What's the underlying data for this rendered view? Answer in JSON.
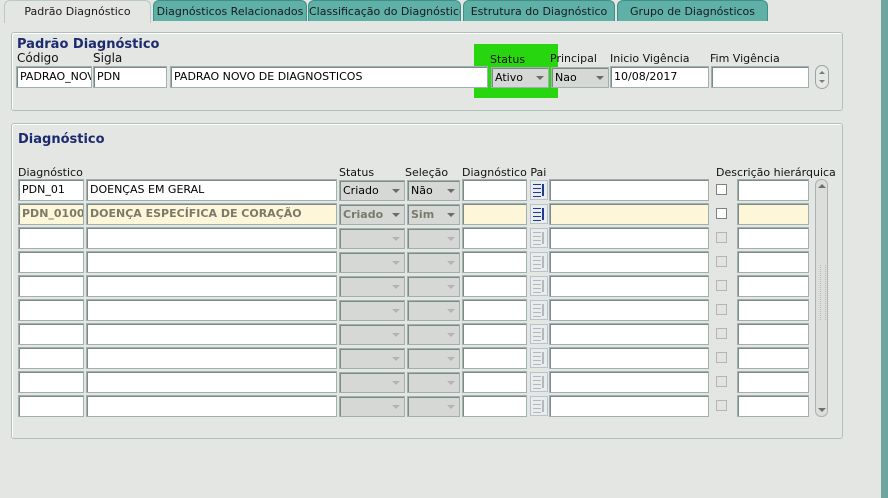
{
  "tabs": [
    {
      "label": "Padrão Diagnóstico",
      "active": true
    },
    {
      "label": "Diagnósticos Relacionados"
    },
    {
      "label": "Classificação do Diagnóstico"
    },
    {
      "label": "Estrutura do Diagnóstico"
    },
    {
      "label": "Grupo de Diagnósticos"
    }
  ],
  "header_panel": {
    "title": "Padrão Diagnóstico",
    "labels": {
      "codigo": "Código",
      "sigla": "Sigla",
      "status": "Status",
      "principal": "Principal",
      "inicio": "Inicio Vigência",
      "fim": "Fim Vigência"
    },
    "codigo": "PADRAO_NOV",
    "sigla": "PDN",
    "descricao": "PADRAO NOVO DE DIAGNOSTICOS",
    "status": "Ativo",
    "principal": "Nao",
    "inicio": "10/08/2017",
    "fim": ""
  },
  "diag_panel": {
    "title": "Diagnóstico",
    "columns": {
      "diagnostico": "Diagnóstico",
      "status": "Status",
      "selecao": "Seleção",
      "pai": "Diagnóstico Pai",
      "descricao_hier": "Descrição hierárquica"
    },
    "rows": [
      {
        "codigo": "PDN_01",
        "descricao": "DOENÇAS EM GERAL",
        "status": "Criado",
        "selecao": "Não"
      },
      {
        "codigo": "PDN_0100",
        "descricao": "DOENÇA ESPECÍFICA DE CORAÇÃO",
        "status": "Criado",
        "selecao": "Sim"
      }
    ]
  },
  "highlight_color": "#27d60f",
  "accent_color": "#1c2a6e",
  "tab_color": "#5fb1a8"
}
